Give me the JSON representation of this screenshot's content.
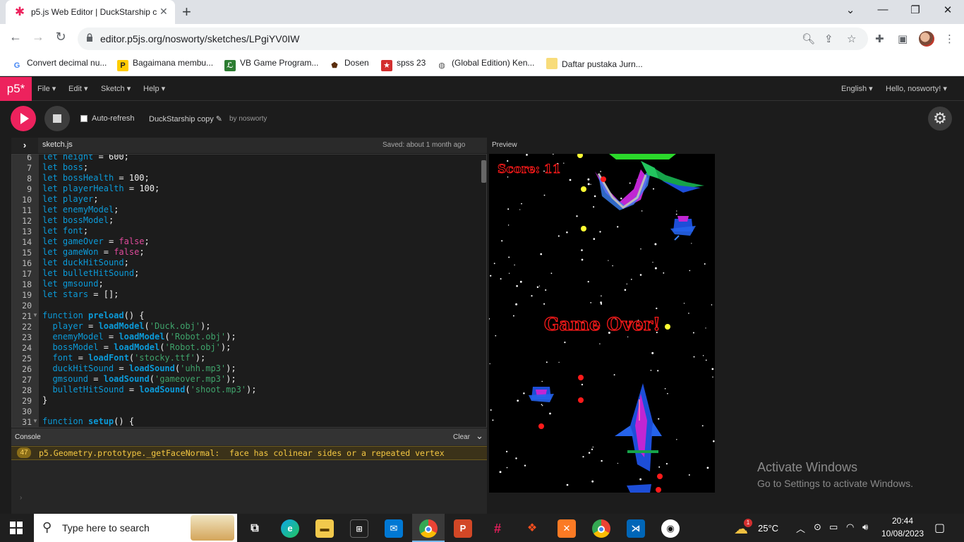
{
  "browser": {
    "tab_title": "p5.js Web Editor | DuckStarship c",
    "url": "editor.p5js.org/nosworty/sketches/LPgiYV0IW",
    "bookmarks": [
      {
        "label": "Convert decimal nu...",
        "icon": "google-icon"
      },
      {
        "label": "Bagaimana membu...",
        "icon": "pelajaran-icon"
      },
      {
        "label": "VB Game Program...",
        "icon": "vb-icon"
      },
      {
        "label": "Dosen",
        "icon": "crest-icon"
      },
      {
        "label": "spss 23",
        "icon": "star-icon"
      },
      {
        "label": "(Global Edition) Ken...",
        "icon": "globe-icon"
      },
      {
        "label": "Daftar pustaka Jurn...",
        "icon": "folder-icon"
      }
    ]
  },
  "p5": {
    "logo": "p5*",
    "menus": [
      "File",
      "Edit",
      "Sketch",
      "Help"
    ],
    "language": "English",
    "user": "Hello, nosworty!",
    "auto_refresh": "Auto-refresh",
    "sketch_name": "DuckStarship copy",
    "by": "by",
    "author": "nosworty",
    "file_name": "sketch.js",
    "saved": "Saved: about 1 month ago",
    "preview": "Preview",
    "console": "Console",
    "clear": "Clear",
    "console_count": "47",
    "console_msg": "p5.Geometry.prototype._getFaceNormal:  face has colinear sides or a repeated vertex"
  },
  "code_lines": [
    {
      "n": "6",
      "text": "let height = 600;"
    },
    {
      "n": "7",
      "text": "let boss;"
    },
    {
      "n": "8",
      "text": "let bossHealth = 100;"
    },
    {
      "n": "9",
      "text": "let playerHealth = 100;"
    },
    {
      "n": "10",
      "text": "let player;"
    },
    {
      "n": "11",
      "text": "let enemyModel;"
    },
    {
      "n": "12",
      "text": "let bossModel;"
    },
    {
      "n": "13",
      "text": "let font;"
    },
    {
      "n": "14",
      "text": "let gameOver = false;"
    },
    {
      "n": "15",
      "text": "let gameWon = false;"
    },
    {
      "n": "16",
      "text": "let duckHitSound;"
    },
    {
      "n": "17",
      "text": "let bulletHitSound;"
    },
    {
      "n": "18",
      "text": "let gmsound;"
    },
    {
      "n": "19",
      "text": "let stars = [];"
    },
    {
      "n": "20",
      "text": ""
    },
    {
      "n": "21",
      "text": "function preload() {"
    },
    {
      "n": "22",
      "text": "  player = loadModel('Duck.obj');"
    },
    {
      "n": "23",
      "text": "  enemyModel = loadModel('Robot.obj');"
    },
    {
      "n": "24",
      "text": "  bossModel = loadModel('Robot.obj');"
    },
    {
      "n": "25",
      "text": "  font = loadFont('stocky.ttf');"
    },
    {
      "n": "26",
      "text": "  duckHitSound = loadSound('uhh.mp3');"
    },
    {
      "n": "27",
      "text": "  gmsound = loadSound('gameover.mp3');"
    },
    {
      "n": "28",
      "text": "  bulletHitSound = loadSound('shoot.mp3');"
    },
    {
      "n": "29",
      "text": "}"
    },
    {
      "n": "30",
      "text": ""
    },
    {
      "n": "31",
      "text": "function setup() {"
    }
  ],
  "game": {
    "score": "Score: 11",
    "game_over": "Game Over!"
  },
  "activation": {
    "title": "Activate Windows",
    "subtitle": "Go to Settings to activate Windows."
  },
  "taskbar": {
    "search_placeholder": "Type here to search",
    "temperature": "25°C",
    "time": "20:44",
    "date": "10/08/2023",
    "weather_badge": "1"
  },
  "colors": {
    "p5_pink": "#ed225d",
    "editor_bg": "#1c1c1c",
    "keyword": "#0b9ad8",
    "string": "#3fa36b",
    "boolean": "#de4a9b",
    "game_text": "#ff1a1a"
  }
}
